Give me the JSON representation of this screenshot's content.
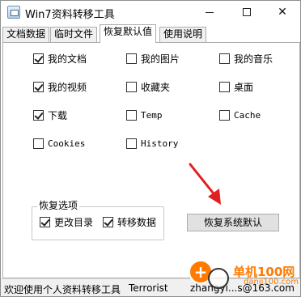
{
  "window": {
    "title": "Win7资料转移工具",
    "min_icon": "minimize-icon",
    "max_icon": "maximize-icon",
    "close_icon": "close-icon",
    "close_glyph": "✕"
  },
  "tabs": [
    {
      "label": "文档数据",
      "active": false
    },
    {
      "label": "临时文件",
      "active": false
    },
    {
      "label": "恢复默认值",
      "active": true
    },
    {
      "label": "使用说明",
      "active": false
    }
  ],
  "folders": [
    {
      "label": "我的文档",
      "checked": true
    },
    {
      "label": "我的图片",
      "checked": false
    },
    {
      "label": "我的音乐",
      "checked": false
    },
    {
      "label": "我的视频",
      "checked": true
    },
    {
      "label": "收藏夹",
      "checked": false
    },
    {
      "label": "桌面",
      "checked": false
    },
    {
      "label": "下载",
      "checked": true
    },
    {
      "label": "Temp",
      "checked": false
    },
    {
      "label": "Cache",
      "checked": false
    },
    {
      "label": "Cookies",
      "checked": false
    },
    {
      "label": "History",
      "checked": false
    }
  ],
  "restore_options": {
    "title": "恢复选项",
    "items": [
      {
        "label": "更改目录",
        "checked": true
      },
      {
        "label": "转移数据",
        "checked": true
      }
    ]
  },
  "restore_button": {
    "label": "恢复系统默认"
  },
  "status": {
    "welcome": "欢迎使用个人资料转移工具",
    "author": "Terrorist",
    "email": "zhangyi...s@163.com"
  },
  "watermark": {
    "site": "单机100网",
    "url": "danji100.com"
  },
  "colors": {
    "arrow": "#e02020",
    "watermark": "#ff7a00"
  }
}
